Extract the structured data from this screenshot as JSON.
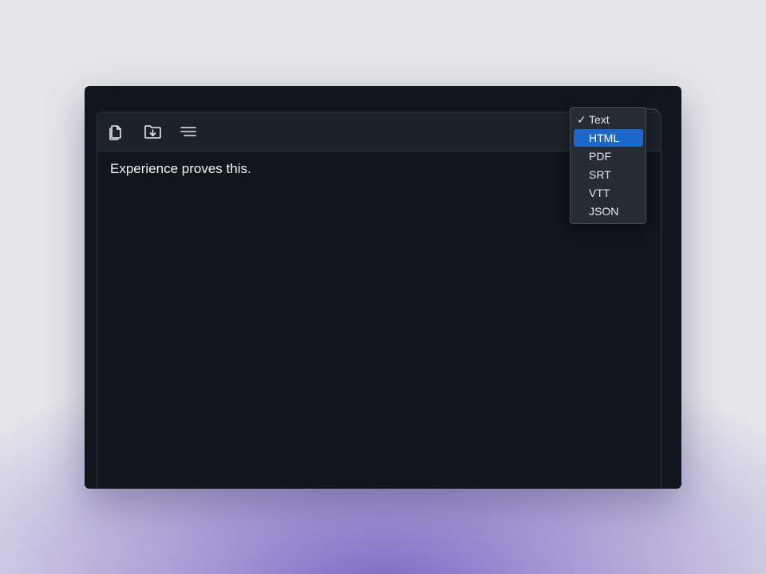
{
  "editor": {
    "text": "Experience proves this."
  },
  "toolbar": {
    "copy_icon": "copy-icon",
    "save_icon": "folder-download-icon",
    "format_icon": "lines-icon"
  },
  "format_menu": {
    "selected": "Text",
    "highlighted": "HTML",
    "check_mark": "✓",
    "options": [
      "Text",
      "HTML",
      "PDF",
      "SRT",
      "VTT",
      "JSON"
    ]
  },
  "colors": {
    "highlight": "#1c68c9",
    "background": "#11151c",
    "toolbar": "#1b2229"
  }
}
